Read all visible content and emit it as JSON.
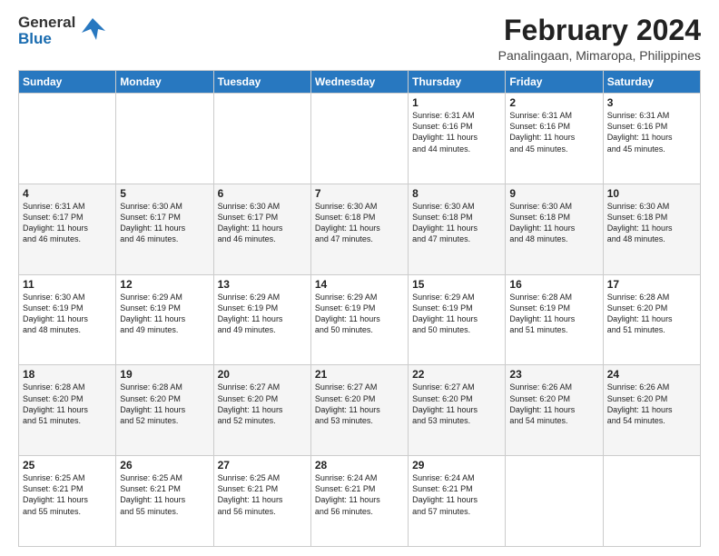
{
  "header": {
    "logo_line1": "General",
    "logo_line2": "Blue",
    "title": "February 2024",
    "subtitle": "Panalingaan, Mimaropa, Philippines"
  },
  "days_of_week": [
    "Sunday",
    "Monday",
    "Tuesday",
    "Wednesday",
    "Thursday",
    "Friday",
    "Saturday"
  ],
  "weeks": [
    [
      {
        "day": "",
        "info": ""
      },
      {
        "day": "",
        "info": ""
      },
      {
        "day": "",
        "info": ""
      },
      {
        "day": "",
        "info": ""
      },
      {
        "day": "1",
        "info": "Sunrise: 6:31 AM\nSunset: 6:16 PM\nDaylight: 11 hours\nand 44 minutes."
      },
      {
        "day": "2",
        "info": "Sunrise: 6:31 AM\nSunset: 6:16 PM\nDaylight: 11 hours\nand 45 minutes."
      },
      {
        "day": "3",
        "info": "Sunrise: 6:31 AM\nSunset: 6:16 PM\nDaylight: 11 hours\nand 45 minutes."
      }
    ],
    [
      {
        "day": "4",
        "info": "Sunrise: 6:31 AM\nSunset: 6:17 PM\nDaylight: 11 hours\nand 46 minutes."
      },
      {
        "day": "5",
        "info": "Sunrise: 6:30 AM\nSunset: 6:17 PM\nDaylight: 11 hours\nand 46 minutes."
      },
      {
        "day": "6",
        "info": "Sunrise: 6:30 AM\nSunset: 6:17 PM\nDaylight: 11 hours\nand 46 minutes."
      },
      {
        "day": "7",
        "info": "Sunrise: 6:30 AM\nSunset: 6:18 PM\nDaylight: 11 hours\nand 47 minutes."
      },
      {
        "day": "8",
        "info": "Sunrise: 6:30 AM\nSunset: 6:18 PM\nDaylight: 11 hours\nand 47 minutes."
      },
      {
        "day": "9",
        "info": "Sunrise: 6:30 AM\nSunset: 6:18 PM\nDaylight: 11 hours\nand 48 minutes."
      },
      {
        "day": "10",
        "info": "Sunrise: 6:30 AM\nSunset: 6:18 PM\nDaylight: 11 hours\nand 48 minutes."
      }
    ],
    [
      {
        "day": "11",
        "info": "Sunrise: 6:30 AM\nSunset: 6:19 PM\nDaylight: 11 hours\nand 48 minutes."
      },
      {
        "day": "12",
        "info": "Sunrise: 6:29 AM\nSunset: 6:19 PM\nDaylight: 11 hours\nand 49 minutes."
      },
      {
        "day": "13",
        "info": "Sunrise: 6:29 AM\nSunset: 6:19 PM\nDaylight: 11 hours\nand 49 minutes."
      },
      {
        "day": "14",
        "info": "Sunrise: 6:29 AM\nSunset: 6:19 PM\nDaylight: 11 hours\nand 50 minutes."
      },
      {
        "day": "15",
        "info": "Sunrise: 6:29 AM\nSunset: 6:19 PM\nDaylight: 11 hours\nand 50 minutes."
      },
      {
        "day": "16",
        "info": "Sunrise: 6:28 AM\nSunset: 6:19 PM\nDaylight: 11 hours\nand 51 minutes."
      },
      {
        "day": "17",
        "info": "Sunrise: 6:28 AM\nSunset: 6:20 PM\nDaylight: 11 hours\nand 51 minutes."
      }
    ],
    [
      {
        "day": "18",
        "info": "Sunrise: 6:28 AM\nSunset: 6:20 PM\nDaylight: 11 hours\nand 51 minutes."
      },
      {
        "day": "19",
        "info": "Sunrise: 6:28 AM\nSunset: 6:20 PM\nDaylight: 11 hours\nand 52 minutes."
      },
      {
        "day": "20",
        "info": "Sunrise: 6:27 AM\nSunset: 6:20 PM\nDaylight: 11 hours\nand 52 minutes."
      },
      {
        "day": "21",
        "info": "Sunrise: 6:27 AM\nSunset: 6:20 PM\nDaylight: 11 hours\nand 53 minutes."
      },
      {
        "day": "22",
        "info": "Sunrise: 6:27 AM\nSunset: 6:20 PM\nDaylight: 11 hours\nand 53 minutes."
      },
      {
        "day": "23",
        "info": "Sunrise: 6:26 AM\nSunset: 6:20 PM\nDaylight: 11 hours\nand 54 minutes."
      },
      {
        "day": "24",
        "info": "Sunrise: 6:26 AM\nSunset: 6:20 PM\nDaylight: 11 hours\nand 54 minutes."
      }
    ],
    [
      {
        "day": "25",
        "info": "Sunrise: 6:25 AM\nSunset: 6:21 PM\nDaylight: 11 hours\nand 55 minutes."
      },
      {
        "day": "26",
        "info": "Sunrise: 6:25 AM\nSunset: 6:21 PM\nDaylight: 11 hours\nand 55 minutes."
      },
      {
        "day": "27",
        "info": "Sunrise: 6:25 AM\nSunset: 6:21 PM\nDaylight: 11 hours\nand 56 minutes."
      },
      {
        "day": "28",
        "info": "Sunrise: 6:24 AM\nSunset: 6:21 PM\nDaylight: 11 hours\nand 56 minutes."
      },
      {
        "day": "29",
        "info": "Sunrise: 6:24 AM\nSunset: 6:21 PM\nDaylight: 11 hours\nand 57 minutes."
      },
      {
        "day": "",
        "info": ""
      },
      {
        "day": "",
        "info": ""
      }
    ]
  ]
}
